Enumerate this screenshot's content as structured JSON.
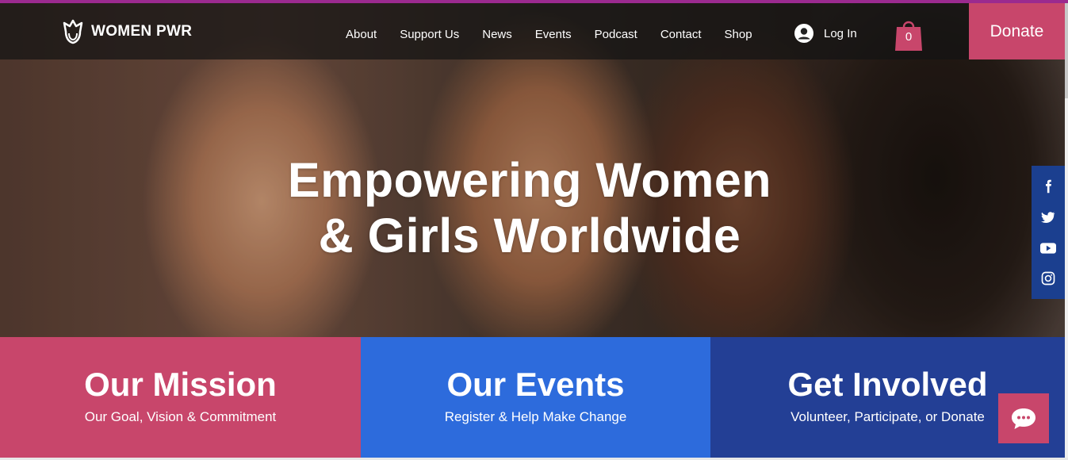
{
  "brand": {
    "name": "WOMEN PWR",
    "logo_icon": "crown-flower-icon"
  },
  "nav": {
    "items": [
      "About",
      "Support Us",
      "News",
      "Events",
      "Podcast",
      "Contact",
      "Shop"
    ]
  },
  "account": {
    "login_label": "Log In",
    "icon": "user-avatar-icon"
  },
  "cart": {
    "count": "0",
    "icon": "shopping-bag-icon"
  },
  "donate": {
    "label": "Donate"
  },
  "hero": {
    "headline_line1": "Empowering Women",
    "headline_line2": "& Girls Worldwide"
  },
  "social": {
    "icons": [
      "facebook-icon",
      "twitter-icon",
      "youtube-icon",
      "instagram-icon"
    ]
  },
  "panels": [
    {
      "title": "Our Mission",
      "subtitle": "Our Goal, Vision & Commitment"
    },
    {
      "title": "Our Events",
      "subtitle": "Register & Help Make Change"
    },
    {
      "title": "Get Involved",
      "subtitle": "Volunteer, Participate, or Donate"
    }
  ],
  "chat": {
    "icon": "chat-bubble-icon"
  },
  "colors": {
    "pink": "#c8466b",
    "blue": "#2d6bdc",
    "navy": "#233f95",
    "social_bar": "#1b3f8f",
    "top_line": "#9b2a8f"
  }
}
